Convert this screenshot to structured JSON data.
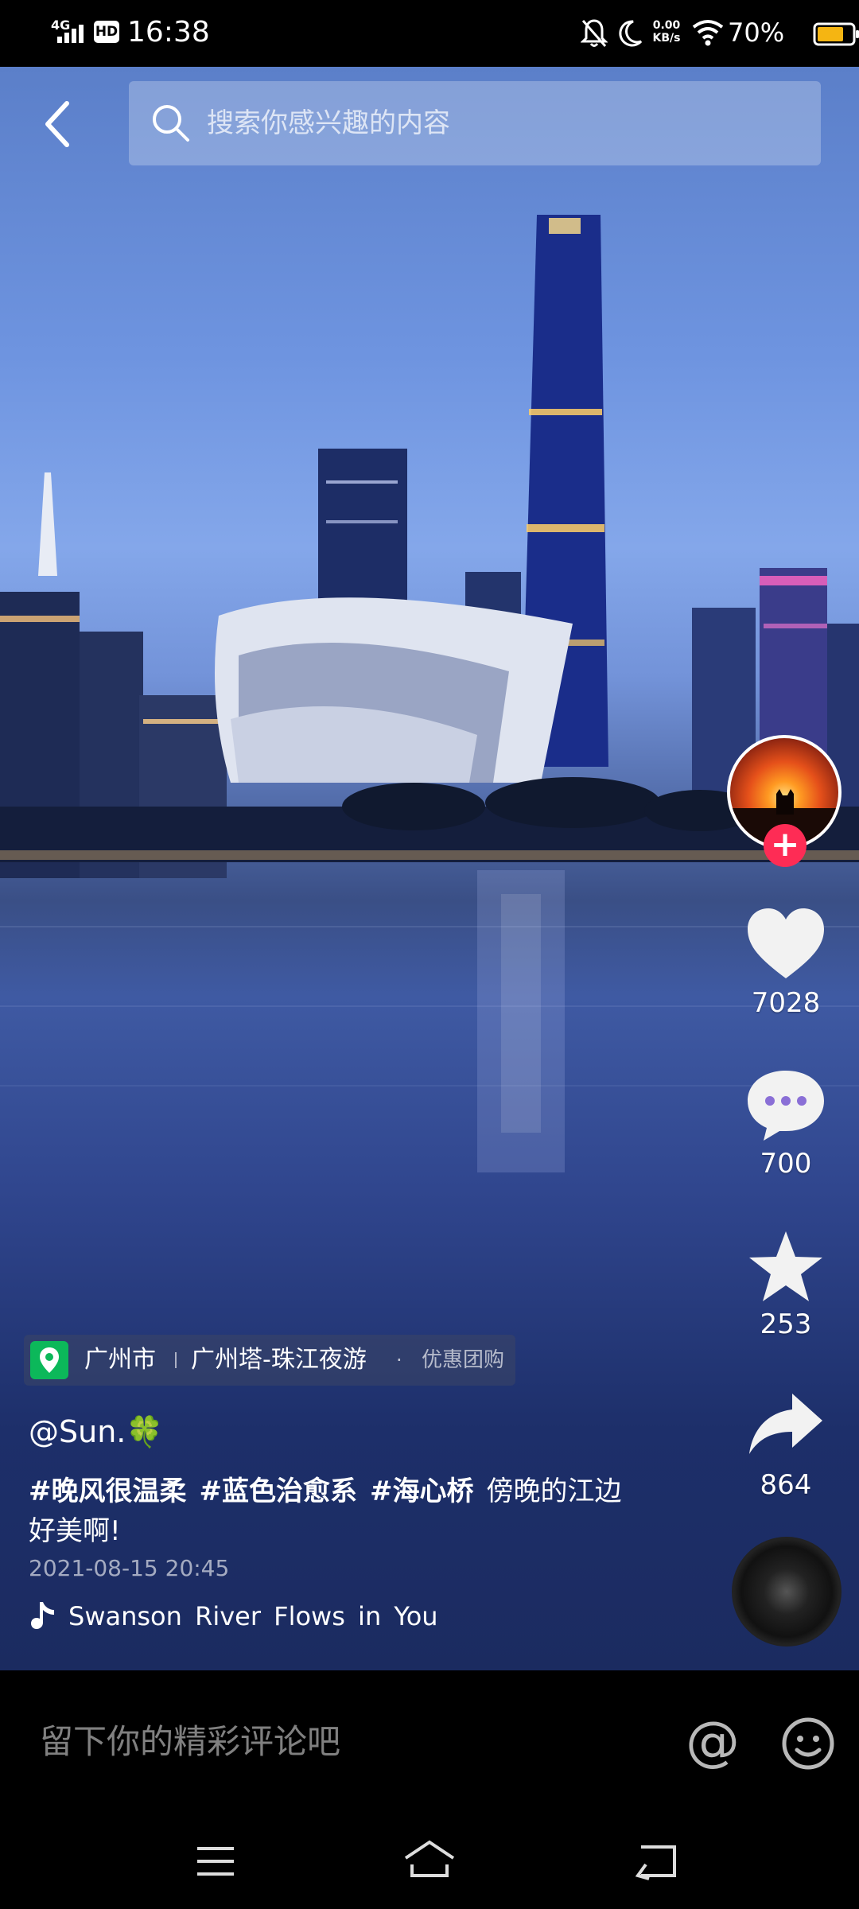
{
  "status_bar": {
    "network": "4G",
    "hd": "HD",
    "time": "16:38",
    "speed_value": "0.00",
    "speed_unit": "KB/s",
    "battery": "70%"
  },
  "search": {
    "placeholder": "搜索你感兴趣的内容"
  },
  "video": {
    "likes": "7028",
    "comments": "700",
    "favorites": "253",
    "shares": "864",
    "location": {
      "city": "广州市",
      "poi": "广州塔-珠江夜游",
      "separator_dot": "·",
      "deal": "优惠团购"
    },
    "author": "@Sun.🍀",
    "hashtags": [
      "#晚风很温柔",
      "#蓝色治愈系",
      "#海心桥"
    ],
    "caption_text": "傍晚的江边好美啊!",
    "date": "2021-08-15  20:45",
    "music": "Swanson      River  Flows  in  You"
  },
  "comment_bar": {
    "placeholder": "留下你的精彩评论吧",
    "at_symbol": "@"
  },
  "colors": {
    "accent": "#fe2c55",
    "location_green": "#0cb85a"
  }
}
